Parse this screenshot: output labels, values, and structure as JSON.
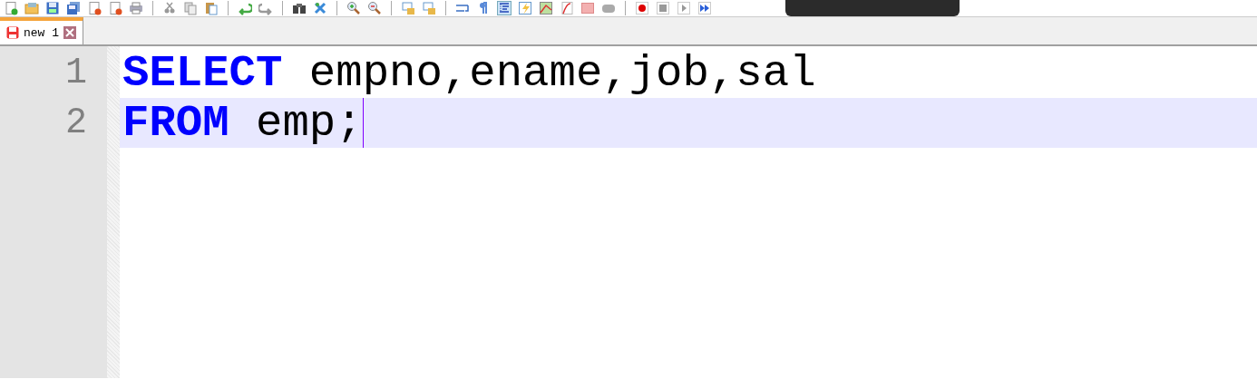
{
  "tabs": [
    {
      "label": "new 1",
      "selected": true,
      "unsaved": true
    }
  ],
  "editor": {
    "lines": [
      {
        "number": "1",
        "current": false,
        "caret": false,
        "tokens": [
          {
            "kind": "keyword",
            "text": "SELECT"
          },
          {
            "kind": "plain",
            "text": " empno,ename,job,sal"
          }
        ]
      },
      {
        "number": "2",
        "current": true,
        "caret": true,
        "tokens": [
          {
            "kind": "keyword",
            "text": "FROM"
          },
          {
            "kind": "plain",
            "text": " emp;"
          }
        ]
      }
    ]
  }
}
